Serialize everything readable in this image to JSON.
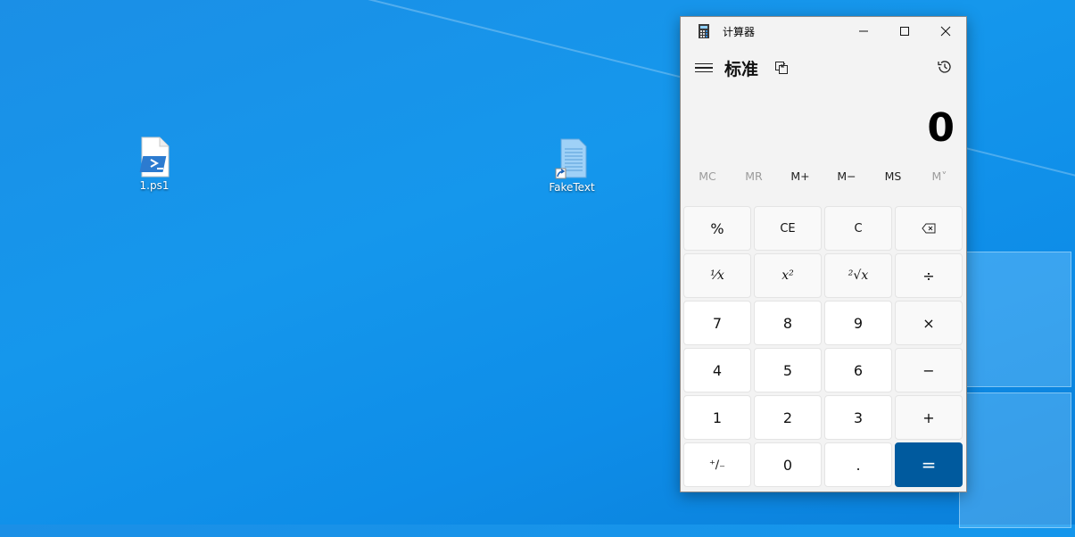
{
  "desktop": {
    "icons": [
      {
        "label": "1.ps1",
        "icon": "powershell-script-icon"
      },
      {
        "label": "FakeText",
        "icon": "text-file-shortcut-icon"
      }
    ]
  },
  "calculator": {
    "window_title": "计算器",
    "mode": "标准",
    "display_value": "0",
    "memory": [
      {
        "label": "MC",
        "enabled": false
      },
      {
        "label": "MR",
        "enabled": false
      },
      {
        "label": "M+",
        "enabled": true
      },
      {
        "label": "M−",
        "enabled": true
      },
      {
        "label": "MS",
        "enabled": true
      },
      {
        "label": "M˅",
        "enabled": false
      }
    ],
    "keys": [
      {
        "label": "%",
        "kind": "op",
        "name": "percent-key"
      },
      {
        "label": "CE",
        "kind": "op",
        "name": "clear-entry-key"
      },
      {
        "label": "C",
        "kind": "op",
        "name": "clear-key"
      },
      {
        "label": "⌫",
        "kind": "op",
        "name": "backspace-key"
      },
      {
        "label": "¹⁄x",
        "kind": "op",
        "name": "reciprocal-key"
      },
      {
        "label": "x²",
        "kind": "op",
        "name": "square-key"
      },
      {
        "label": "²√x",
        "kind": "op",
        "name": "square-root-key"
      },
      {
        "label": "÷",
        "kind": "op",
        "name": "divide-key"
      },
      {
        "label": "7",
        "kind": "num",
        "name": "digit-7-key"
      },
      {
        "label": "8",
        "kind": "num",
        "name": "digit-8-key"
      },
      {
        "label": "9",
        "kind": "num",
        "name": "digit-9-key"
      },
      {
        "label": "×",
        "kind": "op",
        "name": "multiply-key"
      },
      {
        "label": "4",
        "kind": "num",
        "name": "digit-4-key"
      },
      {
        "label": "5",
        "kind": "num",
        "name": "digit-5-key"
      },
      {
        "label": "6",
        "kind": "num",
        "name": "digit-6-key"
      },
      {
        "label": "−",
        "kind": "op",
        "name": "subtract-key"
      },
      {
        "label": "1",
        "kind": "num",
        "name": "digit-1-key"
      },
      {
        "label": "2",
        "kind": "num",
        "name": "digit-2-key"
      },
      {
        "label": "3",
        "kind": "num",
        "name": "digit-3-key"
      },
      {
        "label": "+",
        "kind": "op",
        "name": "add-key"
      },
      {
        "label": "⁺∕₋",
        "kind": "num",
        "name": "negate-key"
      },
      {
        "label": "0",
        "kind": "num",
        "name": "digit-0-key"
      },
      {
        "label": ".",
        "kind": "num",
        "name": "decimal-key"
      },
      {
        "label": "=",
        "kind": "eq",
        "name": "equals-key"
      }
    ],
    "accent_color": "#005a9e"
  }
}
